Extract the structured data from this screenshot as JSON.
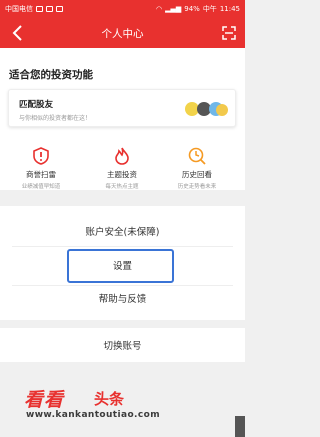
{
  "status_bar": {
    "carrier": "中国电信",
    "battery": "94%",
    "carrier_right": "中午",
    "time": "11:45"
  },
  "nav": {
    "title": "个人中心",
    "back_icon": "back-icon",
    "scan_icon": "scan-icon"
  },
  "invest": {
    "title": "适合您的投资功能",
    "match": {
      "title": "匹配股友",
      "subtitle": "与你相似的投资者都在这！"
    },
    "functions": [
      {
        "label": "商誉扫雷",
        "sub": "业绩减值早知道",
        "icon": "shield-icon",
        "color": "#e8312f"
      },
      {
        "label": "主题投资",
        "sub": "每天热点主题",
        "icon": "flame-icon",
        "color": "#e8312f"
      },
      {
        "label": "历史回看",
        "sub": "历史走势看未来",
        "icon": "clock-search-icon",
        "color": "#f59a23"
      }
    ]
  },
  "menu": {
    "items": [
      {
        "label": "账户安全(未保障)"
      },
      {
        "label": "设置"
      },
      {
        "label": "帮助与反馈"
      }
    ],
    "switch_label": "切换账号"
  },
  "watermark": {
    "brand_a": "看看",
    "brand_b": "头条",
    "url": "www.kankantoutiao.com"
  },
  "colors": {
    "brand_red": "#e8312f",
    "focus_blue": "#3a74d6",
    "clock_orange": "#f59a23"
  }
}
